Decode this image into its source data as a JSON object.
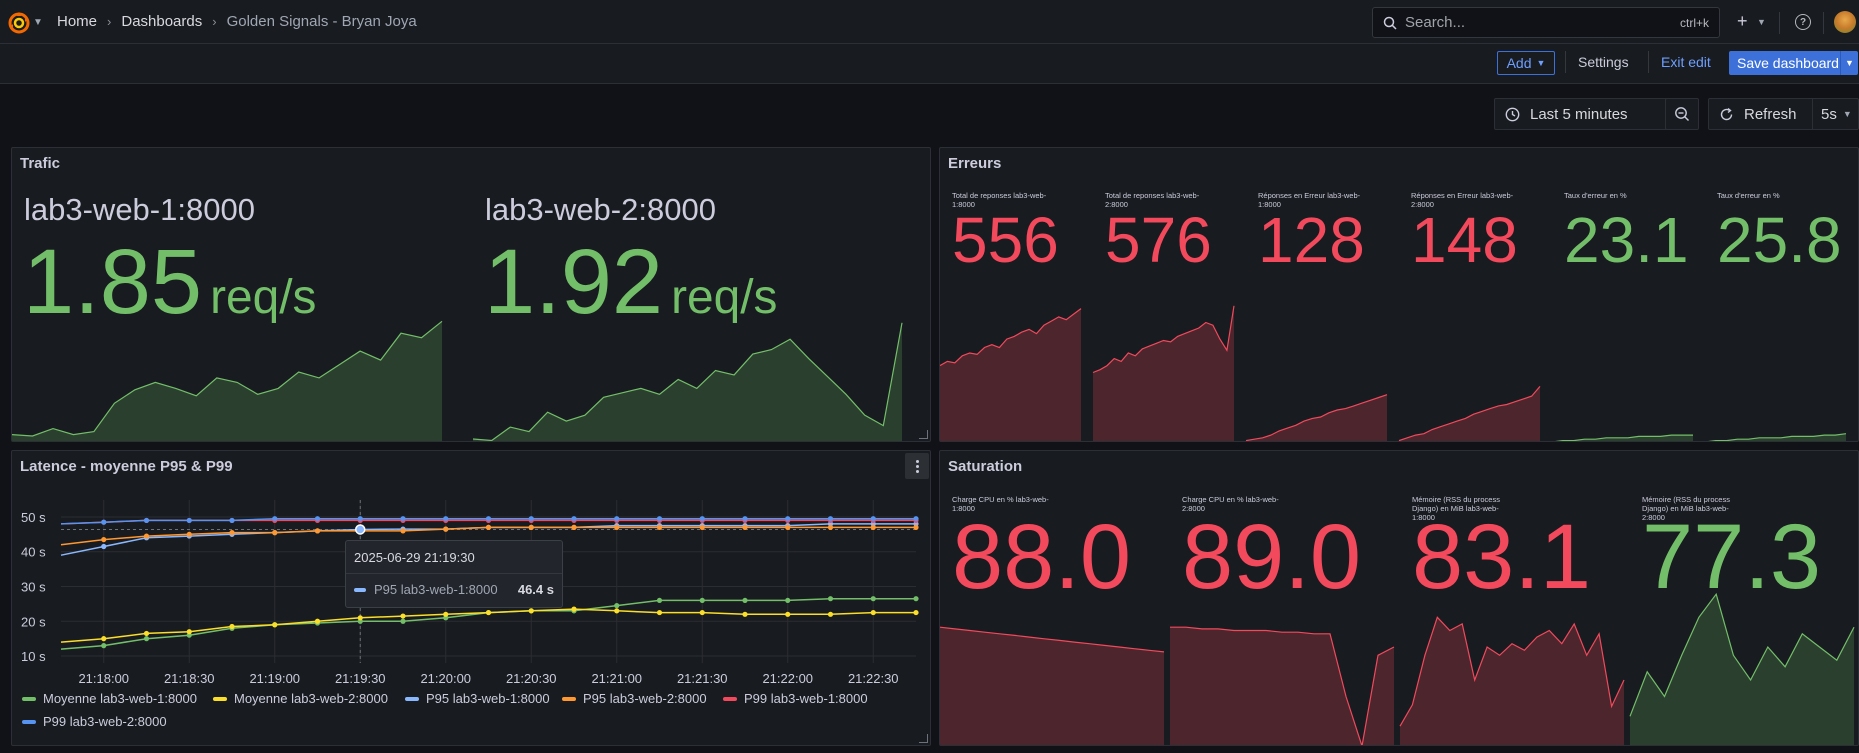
{
  "topbar": {
    "breadcrumbs": [
      "Home",
      "Dashboards",
      "Golden Signals - Bryan Joya"
    ],
    "search_placeholder": "Search...",
    "search_shortcut": "ctrl+k",
    "plus_label": "+"
  },
  "toolbar": {
    "add_label": "Add",
    "settings_label": "Settings",
    "exit_label": "Exit edit",
    "save_label": "Save dashboard"
  },
  "timebar": {
    "range_label": "Last 5 minutes",
    "refresh_label": "Refresh",
    "refresh_interval": "5s"
  },
  "colors": {
    "green": "#73bf69",
    "red": "#f2495c",
    "blue": "#8ab8ff",
    "yellow": "#fade2a",
    "orange": "#ff9830",
    "dark_blue": "#5794f2",
    "accent": "#3d71d9"
  },
  "panels": {
    "trafic": {
      "title": "Trafic",
      "stats": [
        {
          "name": "lab3-web-1:8000",
          "value": "1.85",
          "unit": "req/s",
          "spark": [
            0.05,
            0.04,
            0.09,
            0.05,
            0.07,
            0.26,
            0.35,
            0.4,
            0.36,
            0.31,
            0.43,
            0.4,
            0.32,
            0.36,
            0.47,
            0.43,
            0.52,
            0.61,
            0.55,
            0.73,
            0.7,
            0.81
          ]
        },
        {
          "name": "lab3-web-2:8000",
          "value": "1.92",
          "unit": "req/s",
          "spark": [
            0.02,
            0.01,
            0.1,
            0.07,
            0.2,
            0.14,
            0.18,
            0.3,
            0.33,
            0.36,
            0.32,
            0.42,
            0.36,
            0.48,
            0.45,
            0.59,
            0.62,
            0.69,
            0.56,
            0.44,
            0.32,
            0.18,
            0.11,
            0.8
          ]
        }
      ]
    },
    "erreurs": {
      "title": "Erreurs",
      "stats": [
        {
          "name": "Total de reponses lab3-web-1:8000",
          "value": "556",
          "color": "red",
          "spark": [
            0.55,
            0.58,
            0.57,
            0.62,
            0.64,
            0.63,
            0.68,
            0.7,
            0.68,
            0.74,
            0.76,
            0.79,
            0.81,
            0.78,
            0.84,
            0.87,
            0.9,
            0.88,
            0.92,
            0.96
          ]
        },
        {
          "name": "Total de reponses lab3-web-2:8000",
          "value": "576",
          "color": "red",
          "spark": [
            0.5,
            0.52,
            0.55,
            0.6,
            0.58,
            0.64,
            0.62,
            0.67,
            0.69,
            0.71,
            0.73,
            0.72,
            0.76,
            0.78,
            0.8,
            0.82,
            0.86,
            0.84,
            0.74,
            0.66,
            0.98
          ]
        },
        {
          "name": "Réponses en Erreur lab3-web-1:8000",
          "value": "128",
          "color": "red",
          "spark": [
            0.01,
            0.02,
            0.03,
            0.05,
            0.08,
            0.1,
            0.12,
            0.15,
            0.17,
            0.18,
            0.21,
            0.23,
            0.24,
            0.26,
            0.28,
            0.3,
            0.32,
            0.34
          ]
        },
        {
          "name": "Réponses en Erreur lab3-web-2:8000",
          "value": "148",
          "color": "red",
          "spark": [
            0.01,
            0.03,
            0.05,
            0.06,
            0.09,
            0.11,
            0.13,
            0.15,
            0.17,
            0.2,
            0.22,
            0.24,
            0.26,
            0.27,
            0.29,
            0.31,
            0.33,
            0.4
          ]
        },
        {
          "name": "Taux d'erreur en %",
          "value": "23.1",
          "color": "green",
          "spark": [
            0.0,
            0.01,
            0.01,
            0.02,
            0.02,
            0.03,
            0.03,
            0.03,
            0.04,
            0.04,
            0.04,
            0.05,
            0.05,
            0.05
          ]
        },
        {
          "name": "Taux d'erreur en %",
          "value": "25.8",
          "color": "green",
          "spark": [
            0.0,
            0.01,
            0.01,
            0.02,
            0.02,
            0.03,
            0.03,
            0.03,
            0.04,
            0.04,
            0.04,
            0.05,
            0.05,
            0.06
          ]
        }
      ]
    },
    "latence": {
      "title": "Latence - moyenne P95 & P99",
      "chart_data": {
        "type": "line",
        "x": [
          "21:17:45",
          "21:18:00",
          "21:18:15",
          "21:18:30",
          "21:18:45",
          "21:19:00",
          "21:19:15",
          "21:19:30",
          "21:19:45",
          "21:20:00",
          "21:20:15",
          "21:20:30",
          "21:20:45",
          "21:21:00",
          "21:21:15",
          "21:21:30",
          "21:21:45",
          "21:22:00",
          "21:22:15",
          "21:22:30",
          "21:22:45"
        ],
        "series": [
          {
            "name": "Moyenne lab3-web-1:8000",
            "color": "#73bf69",
            "values": [
              12,
              13,
              15,
              16,
              18,
              19,
              19.5,
              20,
              20,
              21,
              22.5,
              23,
              23,
              24.5,
              26,
              26,
              26,
              26,
              26.5,
              26.5,
              26.5
            ]
          },
          {
            "name": "Moyenne lab3-web-2:8000",
            "color": "#fade2a",
            "values": [
              14,
              15,
              16.5,
              17,
              18.5,
              19,
              20,
              21,
              21.5,
              22,
              22.5,
              23,
              23.5,
              23,
              22.5,
              22.5,
              22,
              22,
              22,
              22.5,
              22.5
            ]
          },
          {
            "name": "P95 lab3-web-1:8000",
            "color": "#8ab8ff",
            "values": [
              39,
              41.5,
              44,
              44.5,
              45,
              45.5,
              46,
              46.4,
              46.5,
              46.5,
              47,
              47,
              47,
              47.5,
              47.5,
              47.5,
              47.5,
              47.5,
              48,
              48,
              48
            ]
          },
          {
            "name": "P95 lab3-web-2:8000",
            "color": "#ff9830",
            "values": [
              42,
              43.5,
              44.5,
              45,
              45.5,
              45.5,
              46,
              46,
              46,
              46.5,
              47,
              47,
              47,
              47,
              47,
              47,
              47,
              47,
              47,
              47,
              47
            ]
          },
          {
            "name": "P99 lab3-web-1:8000",
            "color": "#f2495c",
            "values": [
              48,
              48.5,
              49,
              49,
              49,
              49,
              49,
              49,
              49,
              49,
              49,
              49,
              49,
              49,
              49,
              49,
              49,
              49,
              49,
              49,
              49
            ]
          },
          {
            "name": "P99 lab3-web-2:8000",
            "color": "#5794f2",
            "values": [
              48,
              48.5,
              49,
              49,
              49,
              49.5,
              49.5,
              49.5,
              49.5,
              49.5,
              49.5,
              49.5,
              49.5,
              49.5,
              49.5,
              49.5,
              49.5,
              49.5,
              49.5,
              49.5,
              49.5
            ]
          }
        ],
        "xticks": [
          "21:18:00",
          "21:18:30",
          "21:19:00",
          "21:19:30",
          "21:20:00",
          "21:20:30",
          "21:21:00",
          "21:21:30",
          "21:22:00",
          "21:22:30"
        ],
        "yticks": [
          "10 s",
          "20 s",
          "30 s",
          "40 s",
          "50 s"
        ],
        "ylim": [
          8,
          52
        ],
        "grid": true,
        "legend": "bottom"
      },
      "tooltip": {
        "time": "2025-06-29 21:19:30",
        "series": "P95 lab3-web-1:8000",
        "value": "46.4 s"
      }
    },
    "saturation": {
      "title": "Saturation",
      "stats": [
        {
          "name": "Charge CPU en % lab3-web-1:8000",
          "value": "88.0",
          "color": "red",
          "spark": [
            0.72,
            0.71,
            0.7,
            0.69,
            0.68,
            0.67,
            0.66,
            0.65,
            0.64,
            0.63,
            0.62,
            0.61,
            0.6,
            0.59,
            0.58,
            0.57
          ]
        },
        {
          "name": "Charge CPU en % lab3-web-2:8000",
          "value": "89.0",
          "color": "red",
          "spark": [
            0.72,
            0.72,
            0.71,
            0.71,
            0.7,
            0.7,
            0.7,
            0.69,
            0.69,
            0.68,
            0.68,
            0.3,
            0.0,
            0.55,
            0.6
          ]
        },
        {
          "name": "Mémoire (RSS du process Django) en MiB lab3-web-1:8000",
          "value": "83.1",
          "color": "red",
          "spark": [
            0.12,
            0.25,
            0.55,
            0.78,
            0.7,
            0.74,
            0.4,
            0.6,
            0.55,
            0.62,
            0.58,
            0.66,
            0.7,
            0.62,
            0.74,
            0.55,
            0.68,
            0.24,
            0.4
          ]
        },
        {
          "name": "Mémoire (RSS du process Django) en MiB lab3-web-2:8000",
          "value": "77.3",
          "color": "green",
          "spark": [
            0.18,
            0.45,
            0.3,
            0.55,
            0.78,
            0.92,
            0.55,
            0.4,
            0.6,
            0.48,
            0.68,
            0.6,
            0.52,
            0.72
          ]
        }
      ]
    }
  }
}
